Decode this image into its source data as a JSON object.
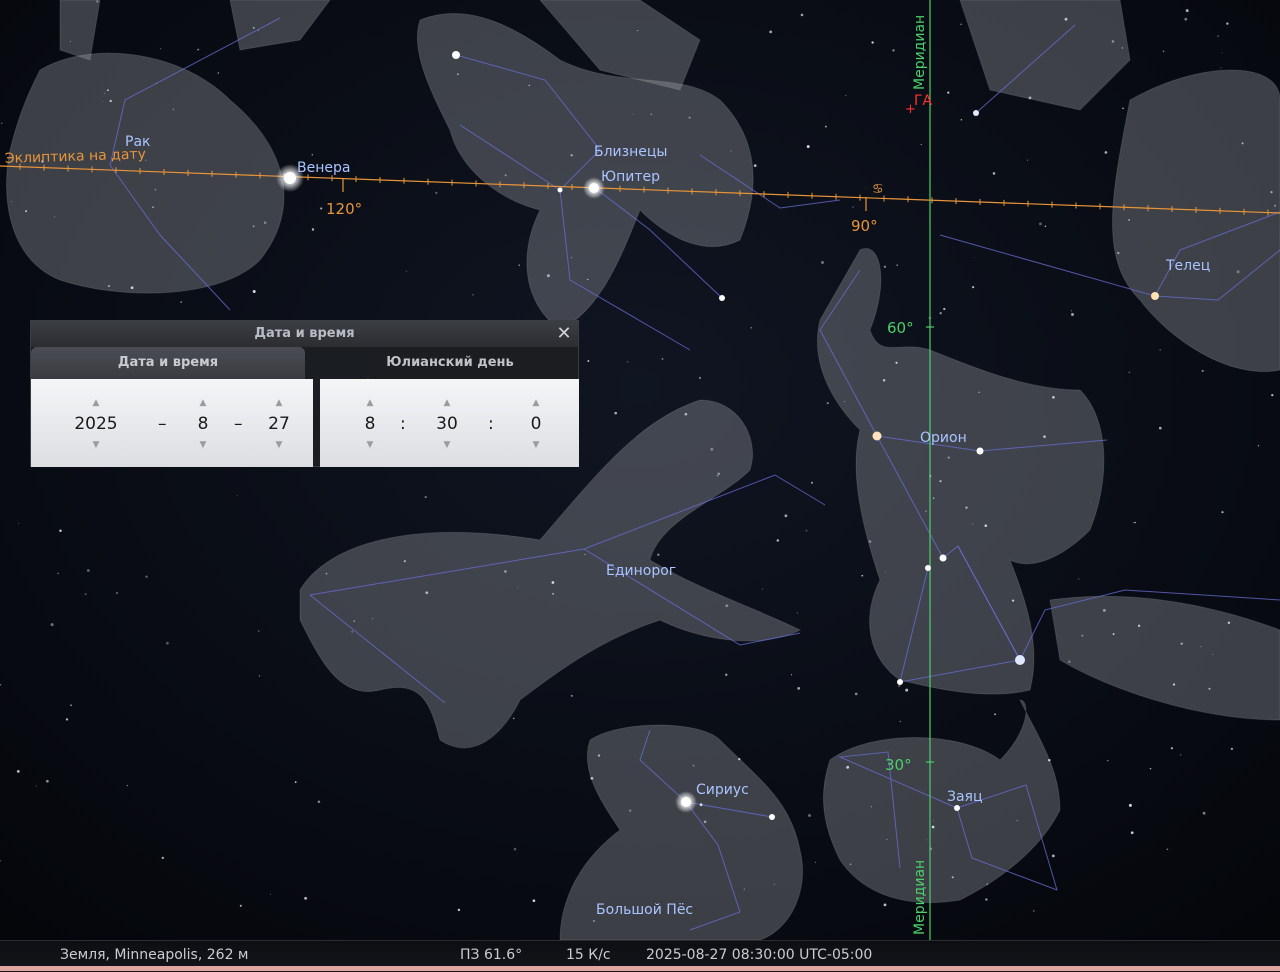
{
  "sky": {
    "ecliptic_label": "Эклиптика на дату",
    "ecliptic_ticks": [
      "120°",
      "90°"
    ],
    "meridian_label": "Меридиан",
    "altitude_ticks": [
      "60°",
      "30°"
    ],
    "ga_label": "ГА",
    "constellations": [
      "Рак",
      "Близнецы",
      "Телец",
      "Орион",
      "Единорог",
      "Заяц",
      "Большой Пёс"
    ],
    "planets": [
      "Венера",
      "Юпитер"
    ],
    "stars": [
      "Сириус"
    ],
    "colors": {
      "ecliptic": "#e8953a",
      "meridian": "#4bd06a",
      "constellation_label": "#a9c4ff",
      "ga": "#ff3030"
    }
  },
  "dialog": {
    "title": "Дата и время",
    "close_icon": "close-icon",
    "tabs": [
      "Дата и время",
      "Юлианский день"
    ],
    "date": {
      "year": "2025",
      "month": "8",
      "day": "27",
      "sep": "–"
    },
    "time": {
      "hour": "8",
      "minute": "30",
      "second": "0",
      "sep": ":"
    }
  },
  "status": {
    "location": "Земля, Minneapolis, 262 м",
    "fov": "ПЗ 61.6°",
    "fps": "15 К/с",
    "datetime": "2025-08-27 08:30:00 UTC-05:00"
  }
}
